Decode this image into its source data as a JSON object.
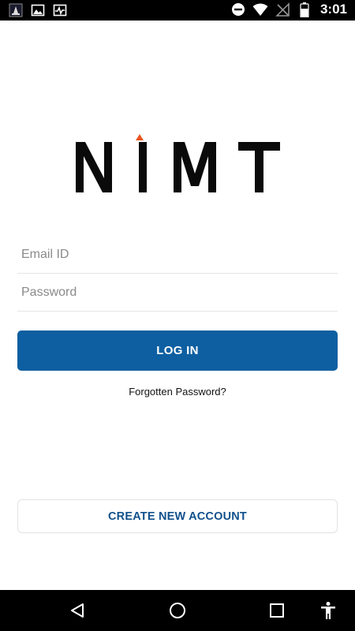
{
  "status_bar": {
    "time": "3:01",
    "left_icons": [
      "app-notification-icon",
      "image-icon",
      "activity-icon"
    ],
    "right_icons": [
      "do-not-disturb-icon",
      "wifi-icon",
      "no-signal-icon",
      "battery-icon"
    ]
  },
  "logo": {
    "text": "NIMT",
    "accent_color": "#e8541e"
  },
  "form": {
    "email_placeholder": "Email ID",
    "password_placeholder": "Password",
    "login_label": "LOG IN",
    "forgot_label": "Forgotten Password?",
    "create_account_label": "CREATE NEW ACCOUNT"
  },
  "colors": {
    "primary": "#0d5fa1",
    "secondary_text": "#10508c"
  },
  "nav_bar": {
    "icons": [
      "back-icon",
      "home-icon",
      "recent-apps-icon",
      "accessibility-icon"
    ]
  }
}
